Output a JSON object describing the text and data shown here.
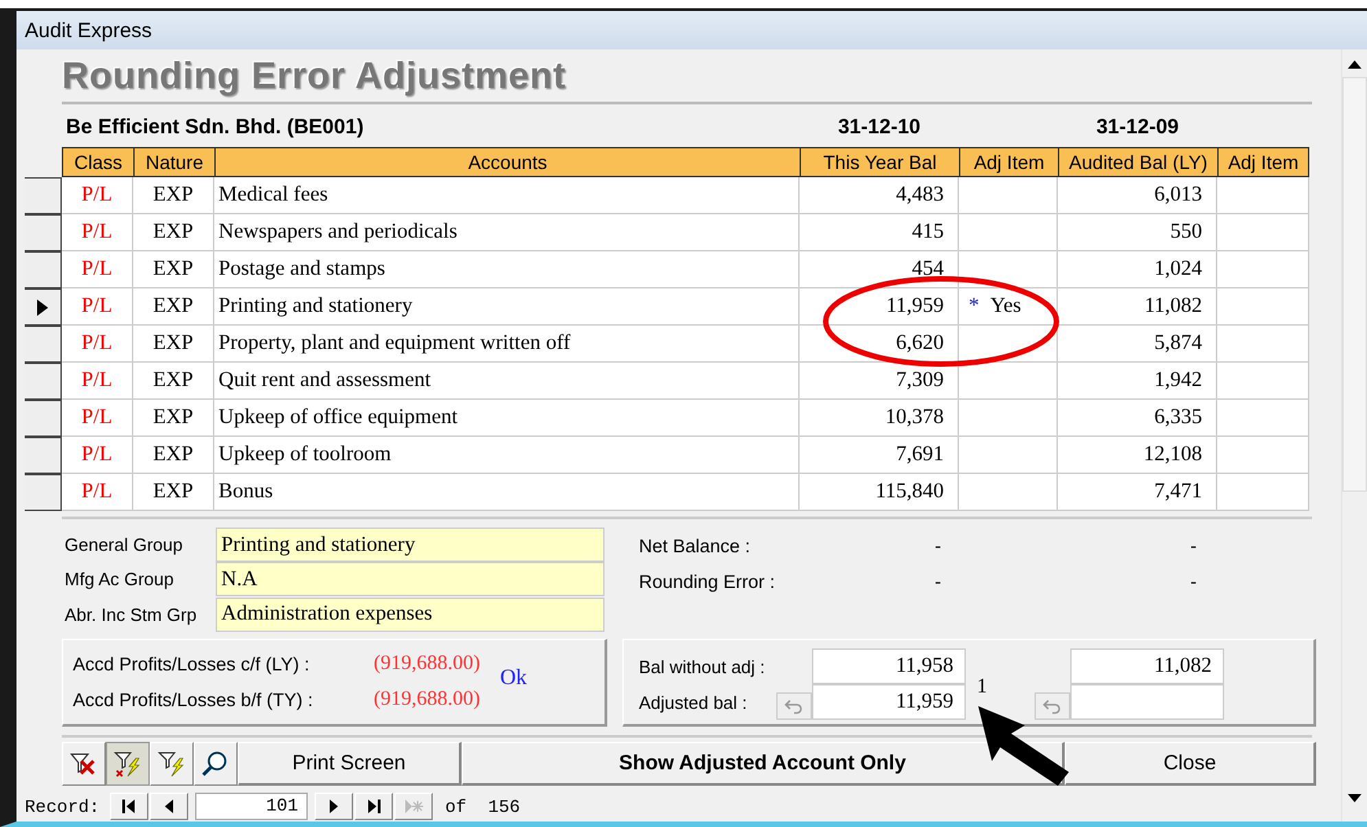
{
  "window": {
    "title": "Audit Express"
  },
  "heading": "Rounding Error Adjustment",
  "company": "Be Efficient Sdn. Bhd.  (BE001)",
  "period_headers": [
    "31-12-10",
    "31-12-09"
  ],
  "table": {
    "columns": [
      "Class",
      "Nature",
      "Accounts",
      "This Year Bal",
      "Adj Item",
      "Audited Bal (LY)",
      "Adj Item"
    ],
    "rows": [
      {
        "class": "P/L",
        "nature": "EXP",
        "account": "Medical fees",
        "this_year_bal": "4,483",
        "audited_bal": "6,013",
        "selected": false
      },
      {
        "class": "P/L",
        "nature": "EXP",
        "account": "Newspapers and periodicals",
        "this_year_bal": "415",
        "audited_bal": "550",
        "selected": false
      },
      {
        "class": "P/L",
        "nature": "EXP",
        "account": "Postage and stamps",
        "this_year_bal": "454",
        "audited_bal": "1,024",
        "selected": false
      },
      {
        "class": "P/L",
        "nature": "EXP",
        "account": "Printing and stationery",
        "this_year_bal": "11,959",
        "adj_mark": "*",
        "adj_item": "Yes",
        "audited_bal": "11,082",
        "selected": true
      },
      {
        "class": "P/L",
        "nature": "EXP",
        "account": "Property, plant and equipment written off",
        "this_year_bal": "6,620",
        "audited_bal": "5,874",
        "selected": false
      },
      {
        "class": "P/L",
        "nature": "EXP",
        "account": "Quit rent and assessment",
        "this_year_bal": "7,309",
        "audited_bal": "1,942",
        "selected": false
      },
      {
        "class": "P/L",
        "nature": "EXP",
        "account": "Upkeep of office equipment",
        "this_year_bal": "10,378",
        "audited_bal": "6,335",
        "selected": false
      },
      {
        "class": "P/L",
        "nature": "EXP",
        "account": "Upkeep of toolroom",
        "this_year_bal": "7,691",
        "audited_bal": "12,108",
        "selected": false
      },
      {
        "class": "P/L",
        "nature": "EXP",
        "account": "Bonus",
        "this_year_bal": "115,840",
        "audited_bal": "7,471",
        "selected": false
      }
    ]
  },
  "groups": [
    {
      "label": "General Group",
      "value": "Printing and stationery"
    },
    {
      "label": "Mfg Ac Group",
      "value": "N.A"
    },
    {
      "label": "Abr. Inc Stm Grp",
      "value": "Administration expenses"
    }
  ],
  "summary": [
    {
      "label": "Net Balance :",
      "this_year": "-",
      "last_year": "-"
    },
    {
      "label": "Rounding Error :",
      "this_year": "-",
      "last_year": "-"
    }
  ],
  "profits": {
    "rows": [
      {
        "label": "Accd Profits/Losses c/f (LY) :",
        "value": "(919,688.00)"
      },
      {
        "label": "Accd Profits/Losses b/f (TY) :",
        "value": "(919,688.00)"
      }
    ],
    "status": "Ok"
  },
  "balances": {
    "without_adj": {
      "label": "Bal without adj :",
      "this_year": "11,958",
      "last_year": "11,082"
    },
    "adjusted": {
      "label": "Adjusted bal :",
      "this_year": "11,959"
    },
    "difference": "1"
  },
  "toolbar": [
    {
      "kind": "remove-filter"
    },
    {
      "kind": "filter-selection",
      "selected": true
    },
    {
      "kind": "filter-form",
      "selected": false
    },
    {
      "kind": "find"
    }
  ],
  "buttons": {
    "print": "Print Screen",
    "show_adjusted": "Show Adjusted Account Only",
    "close": "Close"
  },
  "record_nav": {
    "label": "Record:",
    "value": "101",
    "total": "of  156",
    "buttons": [
      {
        "kind": "first",
        "disabled": false
      },
      {
        "kind": "prev",
        "disabled": false
      },
      {
        "kind": "next",
        "disabled": false
      },
      {
        "kind": "last",
        "disabled": false
      },
      {
        "kind": "new",
        "disabled": true
      }
    ]
  }
}
